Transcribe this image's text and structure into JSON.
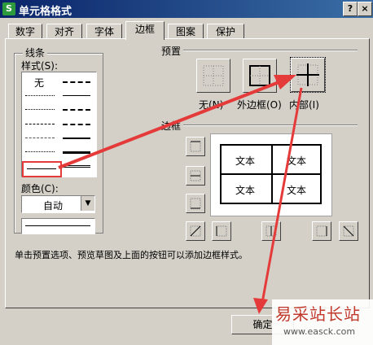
{
  "window": {
    "title": "单元格格式",
    "app_icon": "S",
    "help": "?",
    "close": "×"
  },
  "tabs": [
    "数字",
    "对齐",
    "字体",
    "边框",
    "图案",
    "保护"
  ],
  "active_tab": "边框",
  "line_group": {
    "title": "线条",
    "style_label": "样式(S):",
    "none_label": "无",
    "color_label": "颜色(C):",
    "color_value": "自动"
  },
  "presets": {
    "title": "预置",
    "none": "无(N)",
    "outline": "外边框(O)",
    "inside": "内部(I)"
  },
  "border": {
    "title": "边框",
    "preview_cells": [
      "文本",
      "文本",
      "文本",
      "文本"
    ]
  },
  "hint": "单击预置选项、预览草图及上面的按钮可以添加边框样式。",
  "buttons": {
    "ok": "确定"
  },
  "watermark": {
    "cn": "易采站长站",
    "url": "www.easck.com"
  },
  "colors": {
    "annotation_red": "#e53a3a",
    "title_bar": "#0a246a",
    "dialog_bg": "#d4d0c8"
  }
}
